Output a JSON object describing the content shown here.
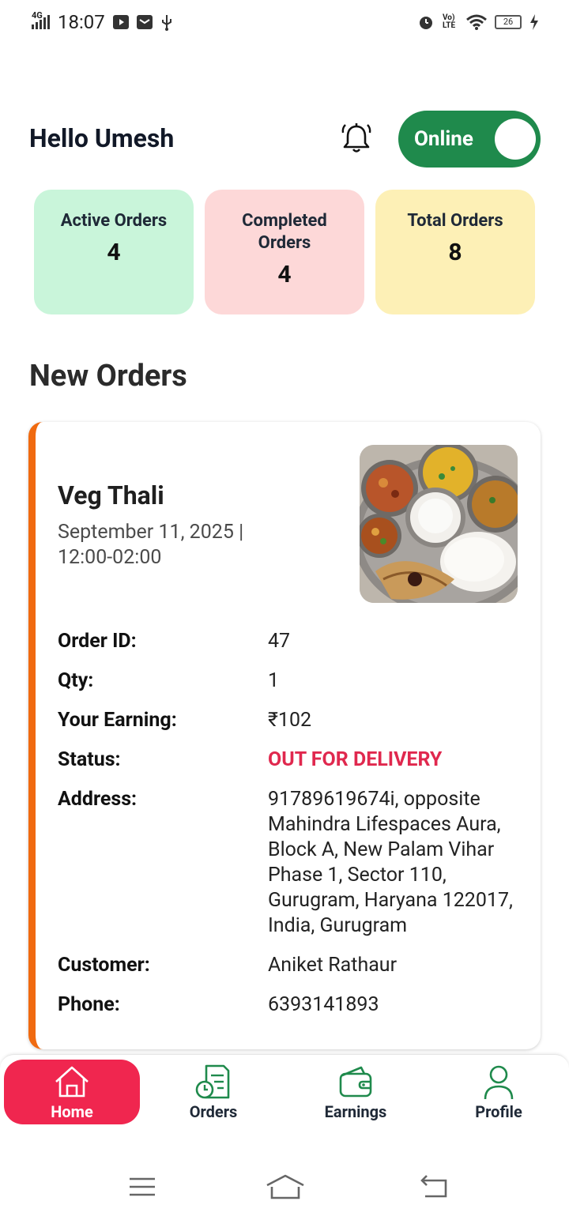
{
  "status_bar": {
    "network": "4G",
    "time": "18:07",
    "volte": "Vo) LTE",
    "battery": "26",
    "icons": [
      "youtube-icon",
      "mail-icon",
      "usb-icon",
      "alarm-icon",
      "wifi-icon",
      "charging-icon"
    ]
  },
  "header": {
    "greeting": "Hello Umesh",
    "online_label": "Online",
    "online": true
  },
  "stats": [
    {
      "label": "Active Orders",
      "value": "4"
    },
    {
      "label": "Completed Orders",
      "value": "4"
    },
    {
      "label": "Total Orders",
      "value": "8"
    }
  ],
  "section_title": "New Orders",
  "order": {
    "name": "Veg Thali",
    "datetime": "September 11, 2025 | 12:00-02:00",
    "fields": [
      {
        "label": "Order ID:",
        "value": "47"
      },
      {
        "label": "Qty:",
        "value": "1"
      },
      {
        "label": "Your Earning:",
        "value": "₹102"
      },
      {
        "label": "Status:",
        "value": "OUT FOR DELIVERY"
      },
      {
        "label": "Address:",
        "value": "91789619674i, opposite Mahindra Lifespaces Aura, Block A, New Palam Vihar Phase 1, Sector 110, Gurugram, Haryana 122017, India, Gurugram"
      },
      {
        "label": "Customer:",
        "value": "Aniket Rathaur"
      },
      {
        "label": "Phone:",
        "value": "6393141893"
      }
    ],
    "status_color": "#e0284e",
    "accent_color": "#f06a10"
  },
  "bottom_nav": {
    "items": [
      {
        "label": "Home",
        "icon": "home-icon",
        "active": true
      },
      {
        "label": "Orders",
        "icon": "orders-icon",
        "active": false
      },
      {
        "label": "Earnings",
        "icon": "wallet-icon",
        "active": false
      },
      {
        "label": "Profile",
        "icon": "profile-icon",
        "active": false
      }
    ],
    "active_color": "#f0264f"
  },
  "colors": {
    "brand_green": "#1f8a4c",
    "active_card": "#c9f5da",
    "completed_card": "#fdd8d8",
    "total_card": "#fdf0b6"
  }
}
